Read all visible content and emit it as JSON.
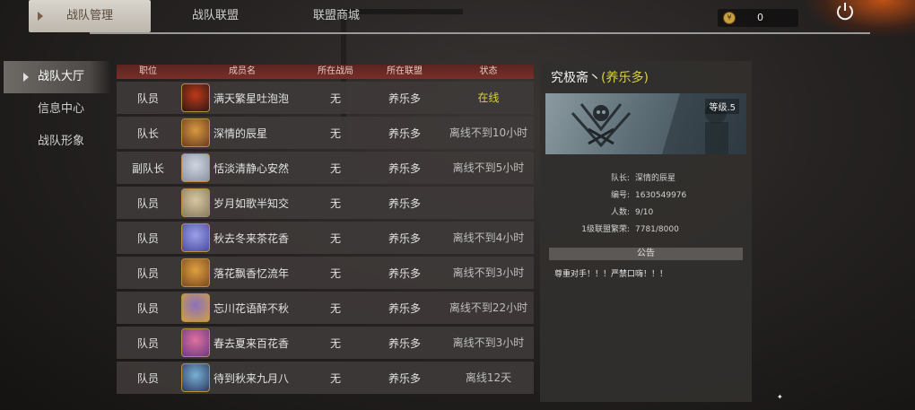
{
  "tabs": [
    {
      "label": "战队管理",
      "active": true
    },
    {
      "label": "战队联盟",
      "active": false
    },
    {
      "label": "联盟商城",
      "active": false
    }
  ],
  "currency": {
    "icon": "coin-icon",
    "value": "0"
  },
  "power_icon": "power-icon",
  "sidebar": {
    "items": [
      {
        "label": "战队大厅",
        "active": true
      },
      {
        "label": "信息中心",
        "active": false
      },
      {
        "label": "战队形象",
        "active": false
      }
    ]
  },
  "table": {
    "headers": [
      "职位",
      "成员名",
      "所在战局",
      "所在联盟",
      "状态"
    ],
    "rows": [
      {
        "role": "队员",
        "name": "满天繁星吐泡泡",
        "game": "无",
        "alliance": "养乐多",
        "status": "在线",
        "online": true
      },
      {
        "role": "队长",
        "name": "深情的辰星",
        "game": "无",
        "alliance": "养乐多",
        "status": "离线不到10小时",
        "online": false
      },
      {
        "role": "副队长",
        "name": "恬淡清静心安然",
        "game": "无",
        "alliance": "养乐多",
        "status": "离线不到5小时",
        "online": false
      },
      {
        "role": "队员",
        "name": "岁月如歌半知交",
        "game": "无",
        "alliance": "养乐多",
        "status": "",
        "online": false
      },
      {
        "role": "队员",
        "name": "秋去冬来茶花香",
        "game": "无",
        "alliance": "养乐多",
        "status": "离线不到4小时",
        "online": false
      },
      {
        "role": "队员",
        "name": "落花飘香忆流年",
        "game": "无",
        "alliance": "养乐多",
        "status": "离线不到3小时",
        "online": false
      },
      {
        "role": "队员",
        "name": "忘川花语醉不秋",
        "game": "无",
        "alliance": "养乐多",
        "status": "离线不到22小时",
        "online": false
      },
      {
        "role": "队员",
        "name": "春去夏来百花香",
        "game": "无",
        "alliance": "养乐多",
        "status": "离线不到3小时",
        "online": false
      },
      {
        "role": "队员",
        "name": "待到秋来九月八",
        "game": "无",
        "alliance": "养乐多",
        "status": "离线12天",
        "online": false
      }
    ]
  },
  "panel": {
    "team_name": "究极斋丶",
    "alliance": "(养乐多)",
    "level": "等级.5",
    "emblem_icon": "skull-wings-emblem",
    "info": [
      {
        "key": "队长:",
        "value": "深情的辰星"
      },
      {
        "key": "编号:",
        "value": "1630549976"
      },
      {
        "key": "人数:",
        "value": "9/10"
      },
      {
        "key": "1级联盟繁荣:",
        "value": "7781/8000"
      }
    ],
    "notice_title": "公告",
    "notice_text": "尊重对手！！！严禁口嗨！！！"
  },
  "colors": {
    "online": "#d8d040",
    "header_red": "#7a2e28",
    "accent_yellow": "#d8d040"
  }
}
